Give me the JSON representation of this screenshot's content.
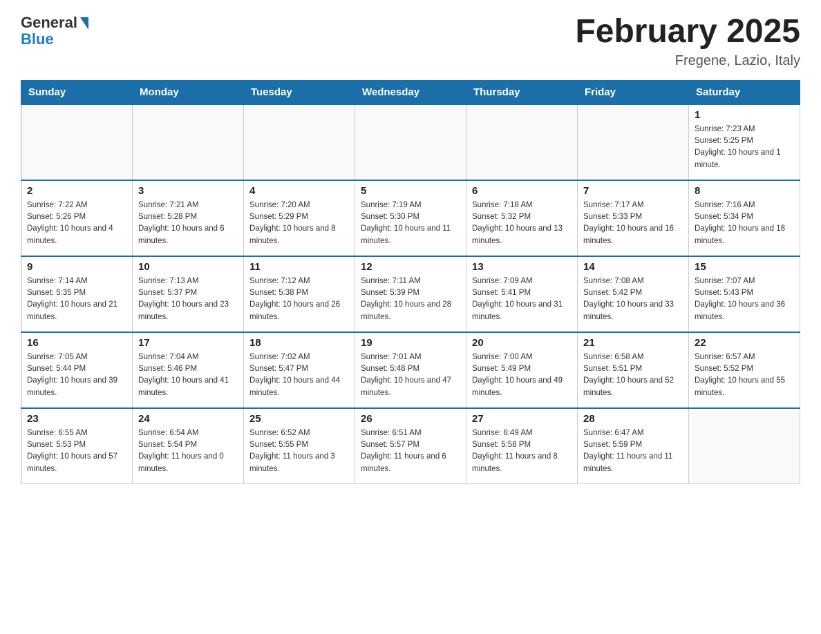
{
  "logo": {
    "general": "General",
    "blue": "Blue"
  },
  "title": "February 2025",
  "subtitle": "Fregene, Lazio, Italy",
  "days_of_week": [
    "Sunday",
    "Monday",
    "Tuesday",
    "Wednesday",
    "Thursday",
    "Friday",
    "Saturday"
  ],
  "weeks": [
    [
      {
        "day": "",
        "info": ""
      },
      {
        "day": "",
        "info": ""
      },
      {
        "day": "",
        "info": ""
      },
      {
        "day": "",
        "info": ""
      },
      {
        "day": "",
        "info": ""
      },
      {
        "day": "",
        "info": ""
      },
      {
        "day": "1",
        "info": "Sunrise: 7:23 AM\nSunset: 5:25 PM\nDaylight: 10 hours and 1 minute."
      }
    ],
    [
      {
        "day": "2",
        "info": "Sunrise: 7:22 AM\nSunset: 5:26 PM\nDaylight: 10 hours and 4 minutes."
      },
      {
        "day": "3",
        "info": "Sunrise: 7:21 AM\nSunset: 5:28 PM\nDaylight: 10 hours and 6 minutes."
      },
      {
        "day": "4",
        "info": "Sunrise: 7:20 AM\nSunset: 5:29 PM\nDaylight: 10 hours and 8 minutes."
      },
      {
        "day": "5",
        "info": "Sunrise: 7:19 AM\nSunset: 5:30 PM\nDaylight: 10 hours and 11 minutes."
      },
      {
        "day": "6",
        "info": "Sunrise: 7:18 AM\nSunset: 5:32 PM\nDaylight: 10 hours and 13 minutes."
      },
      {
        "day": "7",
        "info": "Sunrise: 7:17 AM\nSunset: 5:33 PM\nDaylight: 10 hours and 16 minutes."
      },
      {
        "day": "8",
        "info": "Sunrise: 7:16 AM\nSunset: 5:34 PM\nDaylight: 10 hours and 18 minutes."
      }
    ],
    [
      {
        "day": "9",
        "info": "Sunrise: 7:14 AM\nSunset: 5:35 PM\nDaylight: 10 hours and 21 minutes."
      },
      {
        "day": "10",
        "info": "Sunrise: 7:13 AM\nSunset: 5:37 PM\nDaylight: 10 hours and 23 minutes."
      },
      {
        "day": "11",
        "info": "Sunrise: 7:12 AM\nSunset: 5:38 PM\nDaylight: 10 hours and 26 minutes."
      },
      {
        "day": "12",
        "info": "Sunrise: 7:11 AM\nSunset: 5:39 PM\nDaylight: 10 hours and 28 minutes."
      },
      {
        "day": "13",
        "info": "Sunrise: 7:09 AM\nSunset: 5:41 PM\nDaylight: 10 hours and 31 minutes."
      },
      {
        "day": "14",
        "info": "Sunrise: 7:08 AM\nSunset: 5:42 PM\nDaylight: 10 hours and 33 minutes."
      },
      {
        "day": "15",
        "info": "Sunrise: 7:07 AM\nSunset: 5:43 PM\nDaylight: 10 hours and 36 minutes."
      }
    ],
    [
      {
        "day": "16",
        "info": "Sunrise: 7:05 AM\nSunset: 5:44 PM\nDaylight: 10 hours and 39 minutes."
      },
      {
        "day": "17",
        "info": "Sunrise: 7:04 AM\nSunset: 5:46 PM\nDaylight: 10 hours and 41 minutes."
      },
      {
        "day": "18",
        "info": "Sunrise: 7:02 AM\nSunset: 5:47 PM\nDaylight: 10 hours and 44 minutes."
      },
      {
        "day": "19",
        "info": "Sunrise: 7:01 AM\nSunset: 5:48 PM\nDaylight: 10 hours and 47 minutes."
      },
      {
        "day": "20",
        "info": "Sunrise: 7:00 AM\nSunset: 5:49 PM\nDaylight: 10 hours and 49 minutes."
      },
      {
        "day": "21",
        "info": "Sunrise: 6:58 AM\nSunset: 5:51 PM\nDaylight: 10 hours and 52 minutes."
      },
      {
        "day": "22",
        "info": "Sunrise: 6:57 AM\nSunset: 5:52 PM\nDaylight: 10 hours and 55 minutes."
      }
    ],
    [
      {
        "day": "23",
        "info": "Sunrise: 6:55 AM\nSunset: 5:53 PM\nDaylight: 10 hours and 57 minutes."
      },
      {
        "day": "24",
        "info": "Sunrise: 6:54 AM\nSunset: 5:54 PM\nDaylight: 11 hours and 0 minutes."
      },
      {
        "day": "25",
        "info": "Sunrise: 6:52 AM\nSunset: 5:55 PM\nDaylight: 11 hours and 3 minutes."
      },
      {
        "day": "26",
        "info": "Sunrise: 6:51 AM\nSunset: 5:57 PM\nDaylight: 11 hours and 6 minutes."
      },
      {
        "day": "27",
        "info": "Sunrise: 6:49 AM\nSunset: 5:58 PM\nDaylight: 11 hours and 8 minutes."
      },
      {
        "day": "28",
        "info": "Sunrise: 6:47 AM\nSunset: 5:59 PM\nDaylight: 11 hours and 11 minutes."
      },
      {
        "day": "",
        "info": ""
      }
    ]
  ]
}
